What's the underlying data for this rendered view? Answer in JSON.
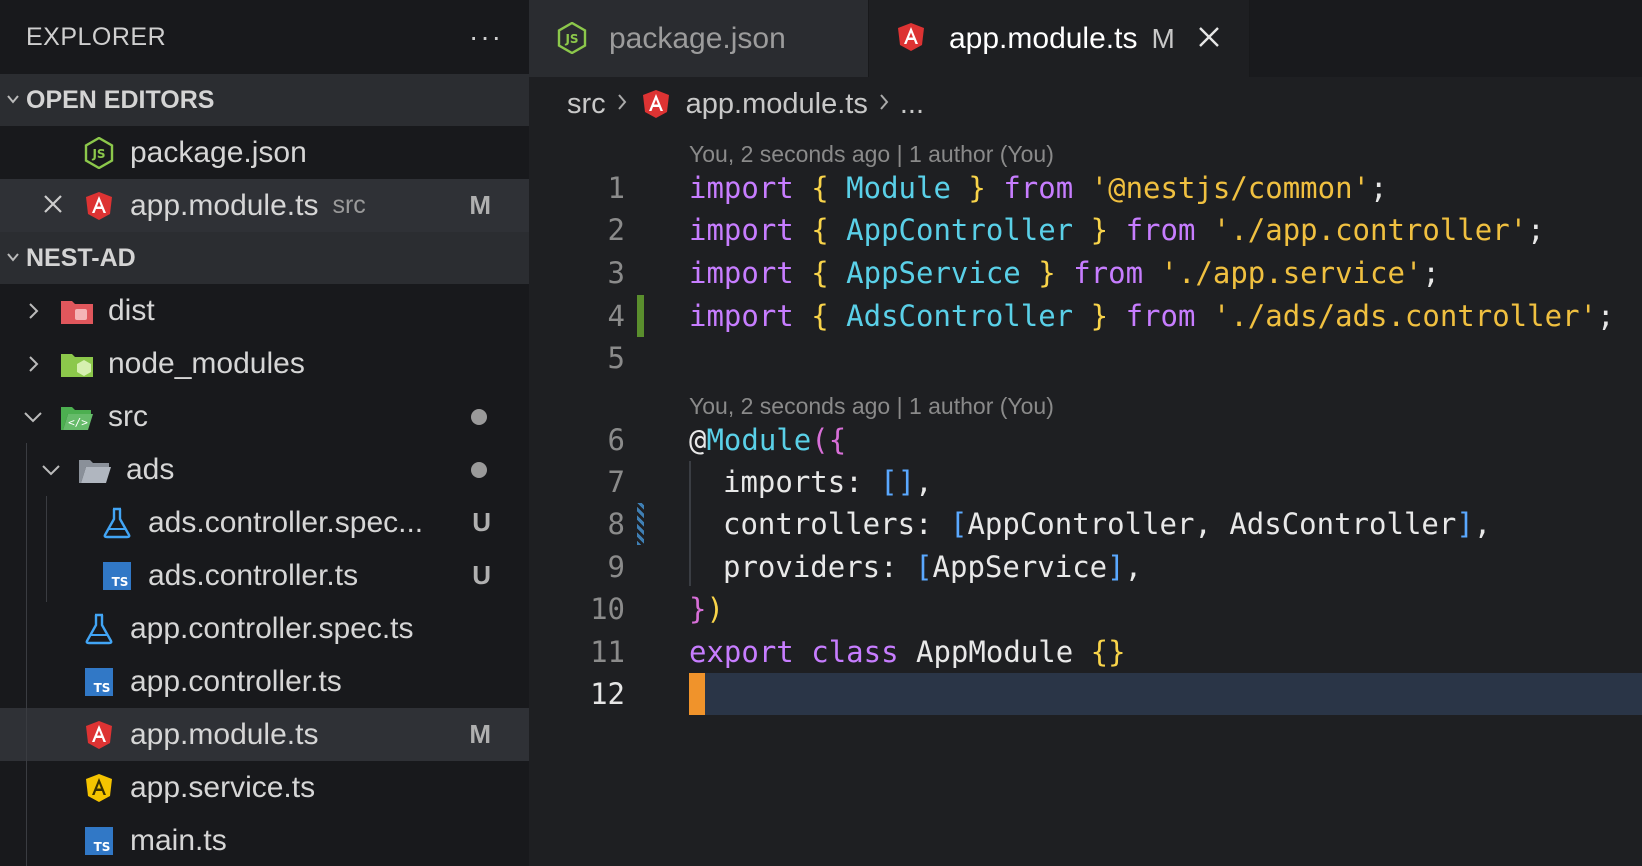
{
  "explorer": {
    "title": "EXPLORER",
    "more": "···"
  },
  "open_editors": {
    "header": "OPEN EDITORS",
    "items": [
      {
        "name": "package.json",
        "icon": "nodejs-icon"
      },
      {
        "name": "app.module.ts",
        "desc": "src",
        "badge": "M",
        "icon": "angular-icon"
      }
    ]
  },
  "project": {
    "header": "NEST-AD",
    "items": [
      {
        "name": "dist"
      },
      {
        "name": "node_modules"
      },
      {
        "name": "src"
      },
      {
        "name": "ads"
      },
      {
        "name": "ads.controller.spec...",
        "badge": "U"
      },
      {
        "name": "ads.controller.ts",
        "badge": "U"
      },
      {
        "name": "app.controller.spec.ts"
      },
      {
        "name": "app.controller.ts"
      },
      {
        "name": "app.module.ts",
        "badge": "M"
      },
      {
        "name": "app.service.ts"
      },
      {
        "name": "main.ts"
      }
    ]
  },
  "tabs": [
    {
      "label": "package.json"
    },
    {
      "label": "app.module.ts",
      "modified": "M",
      "close": "×"
    }
  ],
  "breadcrumb": {
    "folder": "src",
    "file": "app.module.ts",
    "more": "..."
  },
  "codelens": {
    "first": "You, 2 seconds ago | 1 author (You)",
    "second": "You, 2 seconds ago | 1 author (You)"
  },
  "line_numbers": [
    "1",
    "2",
    "3",
    "4",
    "5",
    "6",
    "7",
    "8",
    "9",
    "10",
    "11",
    "12"
  ],
  "code": {
    "l1": {
      "kw": "import",
      "o": "{",
      "id": "Module",
      "c": "}",
      "from": "from",
      "str": "'@nestjs/common'",
      "end": ";"
    },
    "l2": {
      "kw": "import",
      "o": "{",
      "id": "AppController",
      "c": "}",
      "from": "from",
      "str": "'./app.controller'",
      "end": ";"
    },
    "l3": {
      "kw": "import",
      "o": "{",
      "id": "AppService",
      "c": "}",
      "from": "from",
      "str": "'./app.service'",
      "end": ";"
    },
    "l4": {
      "kw": "import",
      "o": "{",
      "id": "AdsController",
      "c": "}",
      "from": "from",
      "str": "'./ads/ads.controller'",
      "end": ";"
    },
    "l6": {
      "at": "@",
      "dec": "Module",
      "p": "(",
      "b": "{"
    },
    "l7": {
      "key": "imports: ",
      "o": "[",
      "c": "]",
      "end": ","
    },
    "l8": {
      "key": "controllers: ",
      "o": "[",
      "val": "AppController, AdsController",
      "c": "]",
      "end": ","
    },
    "l9": {
      "key": "providers: ",
      "o": "[",
      "val": "AppService",
      "c": "]",
      "end": ","
    },
    "l10": {
      "b": "}",
      "p": ")"
    },
    "l11": {
      "kw": "export",
      "kw2": "class",
      "name": "AppModule",
      "braces": "{}"
    }
  }
}
